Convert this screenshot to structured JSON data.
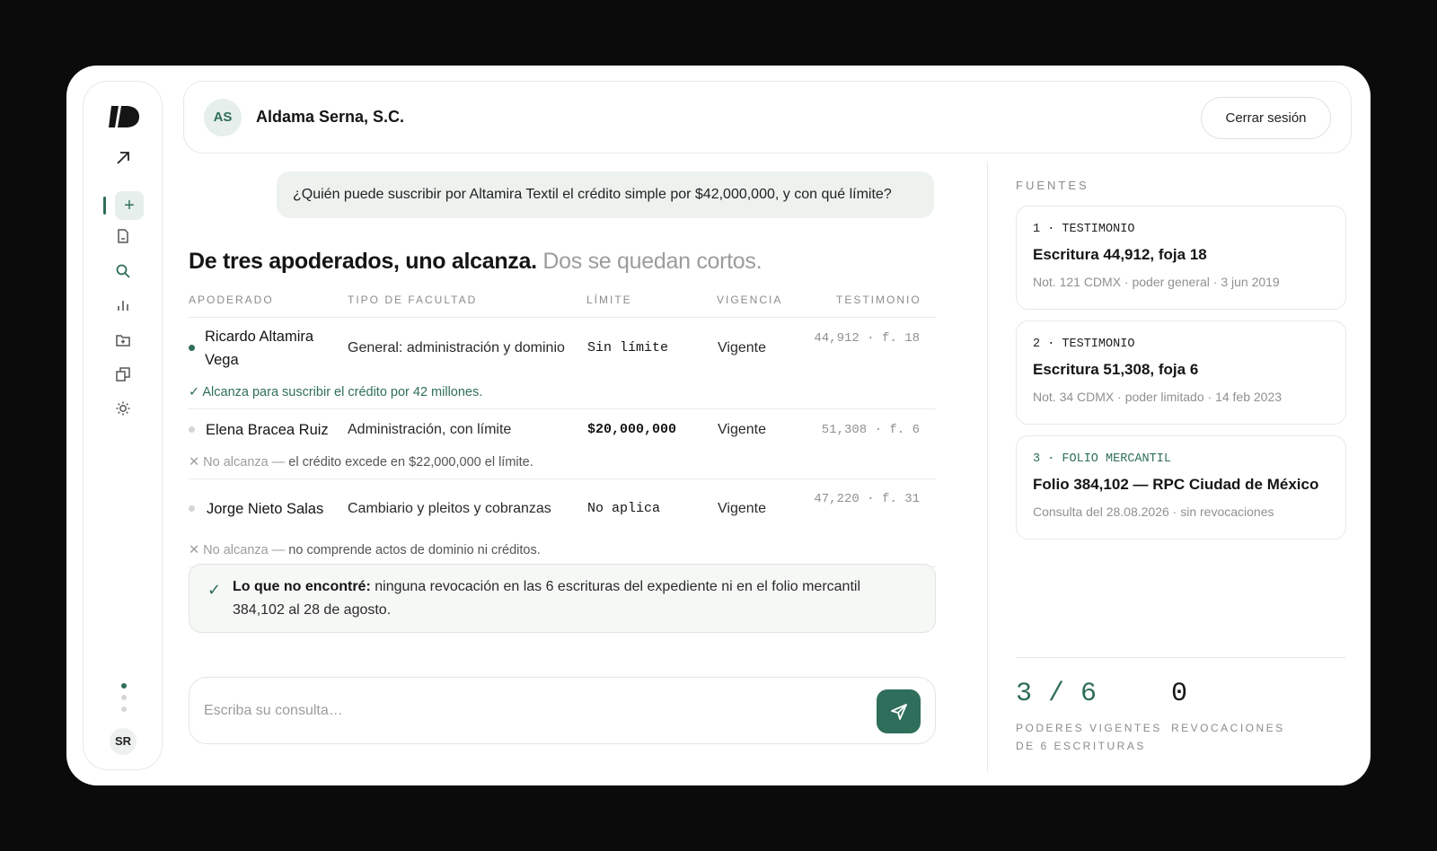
{
  "sidebar": {
    "new_label": "+",
    "icons": [
      "arrow-up-right-icon",
      "document-icon",
      "search-icon",
      "bar-chart-icon",
      "folder-plus-icon",
      "copy-icon",
      "sun-icon"
    ],
    "user_initials": "SR"
  },
  "header": {
    "initials": "AS",
    "org_name": "Aldama Serna, S.C.",
    "logout_label": "Cerrar sesión"
  },
  "chat": {
    "question": "¿Quién puede suscribir por Altamira Textil el crédito simple por $42,000,000, y con qué límite?",
    "answer_title": "De tres apoderados, uno alcanza.",
    "answer_subtitle": "Dos se quedan cortos.",
    "columns": [
      "APODERADO",
      "TIPO DE FACULTAD",
      "LÍMITE",
      "VIGENCIA",
      "TESTIMONIO"
    ],
    "rows": [
      {
        "name": "Ricardo Altamira Vega",
        "facultad": "General: administración y dominio",
        "limite": "Sin límite",
        "vigencia": "Vigente",
        "testimonio": "44,912 · f. 18",
        "note_prefix": "✓ Alcanza para suscribir el crédito por 42 millones.",
        "note_rest": "",
        "status_color": "#2f6e5b"
      },
      {
        "name": "Elena Bracea Ruiz",
        "facultad": "Administración, con límite",
        "limite": "$20,000,000",
        "vigencia": "Vigente",
        "testimonio": "51,308 · f. 6",
        "note_prefix": "✕ No alcanza —",
        "note_rest": "el crédito excede en $22,000,000 el límite.",
        "status_color": "#d4d6d4"
      },
      {
        "name": "Jorge Nieto Salas",
        "facultad": "Cambiario y pleitos y cobranzas",
        "limite": "No aplica",
        "vigencia": "Vigente",
        "testimonio": "47,220 · f. 31",
        "note_prefix": "✕ No alcanza —",
        "note_rest": "no comprende actos de dominio ni créditos.",
        "status_color": "#d4d6d4"
      }
    ],
    "callout_bold": "Lo que no encontré:",
    "callout_text": "ninguna revocación en las 6 escrituras del expediente ni en el folio mercantil 384,102 al 28 de agosto.",
    "composer_placeholder": "Escriba su consulta…"
  },
  "sources": {
    "title": "FUENTES",
    "items": [
      {
        "tag": "1 · TESTIMONIO",
        "title": "Escritura 44,912, foja 18",
        "meta": "Not. 121 CDMX · poder general · 3 jun 2019",
        "tag_accent": false
      },
      {
        "tag": "2 · TESTIMONIO",
        "title": "Escritura 51,308, foja 6",
        "meta": "Not. 34 CDMX · poder limitado · 14 feb 2023",
        "tag_accent": false
      },
      {
        "tag": "3 · FOLIO MERCANTIL",
        "title": "Folio 384,102 — RPC Ciudad de México",
        "meta": "Consulta del 28.08.2026 · sin revocaciones",
        "tag_accent": true
      }
    ]
  },
  "stats": {
    "vigentes_value": "3 / 6",
    "vigentes_label_1": "PODERES VIGENTES",
    "vigentes_label_2": "DE 6 ESCRITURAS",
    "revocaciones_value": "0",
    "revocaciones_label": "REVOCACIONES"
  },
  "colors": {
    "accent": "#2f6e5b",
    "accent_soft": "#e6efeb",
    "muted": "#9b9d9b",
    "background": "#0b0b0b"
  }
}
